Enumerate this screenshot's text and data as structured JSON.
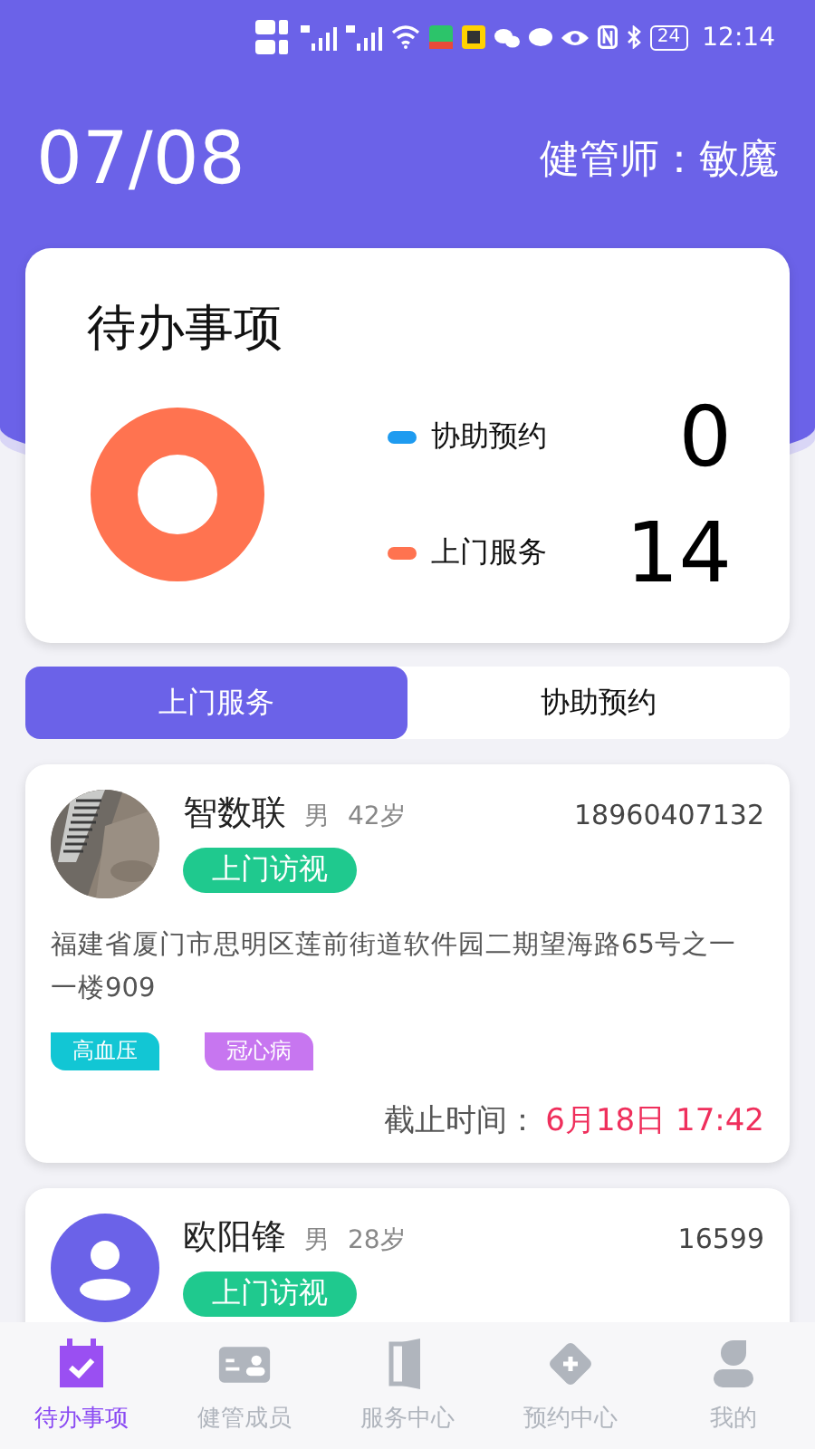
{
  "status_bar": {
    "time": "12:14",
    "battery": "24"
  },
  "header": {
    "date": "07/08",
    "manager": "健管师：敏魔"
  },
  "summary": {
    "title": "待办事项",
    "legend": [
      {
        "label": "协助预约",
        "count": "0",
        "color": "#1e9bf0"
      },
      {
        "label": "上门服务",
        "count": "14",
        "color": "#ff7350"
      }
    ]
  },
  "tabs": [
    {
      "label": "上门服务",
      "selected": true
    },
    {
      "label": "协助预约",
      "selected": false
    }
  ],
  "cards": [
    {
      "name": "智数联",
      "gender": "男",
      "age": "42岁",
      "phone": "18960407132",
      "visit": "上门访视",
      "address": "福建省厦门市思明区莲前街道软件园二期望海路65号之一一楼909",
      "tags": [
        {
          "label": "高血压",
          "color": "#12c6d4"
        },
        {
          "label": "冠心病",
          "color": "#c776f0"
        }
      ],
      "deadline_label": "截止时间：",
      "deadline": "6月18日 17:42"
    },
    {
      "avatar": {
        "kind": "person"
      },
      "name": "欧阳锋",
      "gender": "男",
      "age": "28岁",
      "phone": "16599",
      "visit": "上门访视"
    }
  ],
  "nav": [
    {
      "label": "待办事项",
      "kind": "calendar",
      "selected": true
    },
    {
      "label": "健管成员",
      "kind": "card",
      "selected": false
    },
    {
      "label": "服务中心",
      "kind": "door",
      "selected": false
    },
    {
      "label": "预约中心",
      "kind": "diamond",
      "selected": false
    },
    {
      "label": "我的",
      "kind": "user",
      "selected": false
    }
  ]
}
